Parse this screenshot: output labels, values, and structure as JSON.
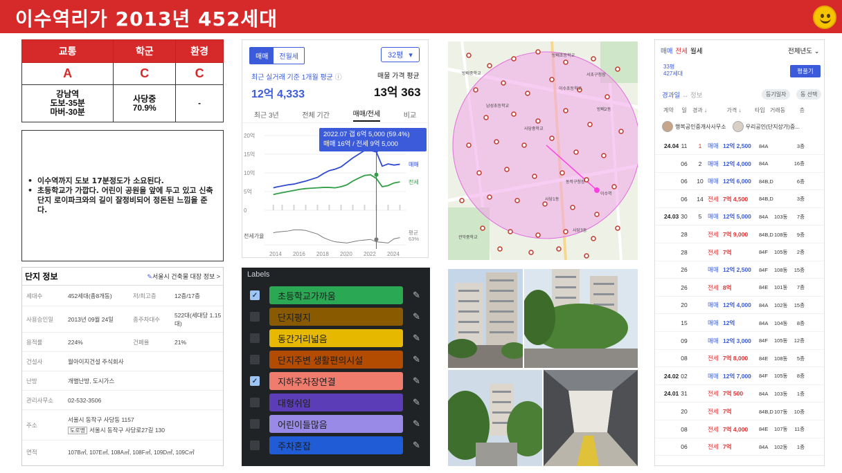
{
  "header": {
    "title": "이수역리가 2013년 452세대"
  },
  "scores": {
    "headers": [
      "교통",
      "학군",
      "환경"
    ],
    "grades": [
      "A",
      "C",
      "C"
    ],
    "details": [
      [
        "강남역",
        "도보-35분",
        "마버-30분"
      ],
      [
        "사당중",
        "70.9%"
      ],
      [
        "-"
      ]
    ]
  },
  "notes": [
    "이수역까지 도보 17분정도가 소요된다.",
    "초등학교가 가깝다. 어린이 공원을 앞에 두고 있고 신축단지 로이파크와의 길이 잘정비되어 정돈된 느낌을 준다."
  ],
  "complex": {
    "title": "단지 정보",
    "link": "서울시 건축물 대장 정보 >",
    "rows": [
      {
        "label": "세대수",
        "value": "452세대(총8개동)",
        "label2": "저/최고층",
        "value2": "12층/17층"
      },
      {
        "label": "사용승인일",
        "value": "2013년 09월 24일",
        "label2": "총주차대수",
        "value2": "522대(세대당 1.15대)"
      },
      {
        "label": "용적률",
        "value": "224%",
        "label2": "건폐율",
        "value2": "21%"
      },
      {
        "label": "건설사",
        "value": "월아이지건설 주식회사"
      },
      {
        "label": "난방",
        "value": "개별난방, 도시가스"
      },
      {
        "label": "관리사무소",
        "value": "02-532-3506"
      },
      {
        "label": "주소",
        "value": "서울시 동작구 사당동 1157",
        "road_tag": "도로명",
        "road": "서울시 동작구 사당로27길 130"
      },
      {
        "label": "면적",
        "value": "107B㎡, 107E㎡, 108A㎡, 108F㎡, 109D㎡, 109C㎡"
      }
    ]
  },
  "price_panel": {
    "tab_sale": "매매",
    "tab_rent": "전월세",
    "size": "32평",
    "avg_label": "최근 실거래 기준 1개월 평균",
    "avg_value": "12억 4,333",
    "sale_avg_label": "매물 가격 평균",
    "sale_avg_value": "13억 363",
    "period_tabs": [
      "최근 3년",
      "전체 기간",
      "매매/전세",
      "비교"
    ],
    "tooltip_line1": "2022.07  갭 6억 5,000 (59.4%)",
    "tooltip_line2": "매매 16억 / 전세 9억 5,000",
    "legend_sale": "매매",
    "legend_jeonse": "전세",
    "gap_label": "전세가율",
    "ratio_label": "평균",
    "ratio_value": "63%"
  },
  "chart_data": {
    "type": "line",
    "x": [
      2013.75,
      2014,
      2014.5,
      2015,
      2015.5,
      2016,
      2016.5,
      2017,
      2017.5,
      2018,
      2018.5,
      2019,
      2019.5,
      2020,
      2020.5,
      2021,
      2021.5,
      2022,
      2022.5,
      2023,
      2023.5,
      2024,
      2024.5
    ],
    "series": [
      {
        "name": "매매",
        "values": [
          6.0,
          6.2,
          6.5,
          6.8,
          7.0,
          7.4,
          7.8,
          8.3,
          8.8,
          9.8,
          10.6,
          11.0,
          11.6,
          12.8,
          14.0,
          15.0,
          16.0,
          16.0,
          15.6,
          11.8,
          12.4,
          12.1,
          12.3
        ]
      },
      {
        "name": "전세",
        "values": [
          4.2,
          4.4,
          4.7,
          5.0,
          5.3,
          5.6,
          5.8,
          5.9,
          6.0,
          6.1,
          6.1,
          6.0,
          6.3,
          6.8,
          7.8,
          8.6,
          9.3,
          9.5,
          8.5,
          6.3,
          6.6,
          7.3,
          7.6
        ]
      },
      {
        "name": "전세가율",
        "values": [
          70,
          71,
          72,
          73,
          75,
          75,
          74,
          71,
          68,
          62,
          58,
          55,
          54,
          53,
          55,
          57,
          58,
          59,
          55,
          54,
          53,
          60,
          62
        ]
      }
    ],
    "yticks": [
      "20억",
      "15억",
      "10억",
      "5억",
      "0"
    ],
    "xticks": [
      "2014",
      "2016",
      "2018",
      "2020",
      "2022",
      "2024"
    ],
    "ylim": [
      0,
      20
    ],
    "xlim": [
      2013,
      2025
    ]
  },
  "map": {
    "labels": [
      "방배중학교",
      "방배초등학교",
      "서초구청장",
      "사당중학교",
      "이수초등학교",
      "남성초등학교",
      "사당1동",
      "사당3동",
      "방배2동",
      "동작구청장",
      "관악중학교",
      "이수역"
    ]
  },
  "labels_panel": {
    "title": "Labels",
    "items": [
      {
        "text": "초등학교가까움",
        "checked": true,
        "color": "#2aa853"
      },
      {
        "text": "단지평지",
        "checked": false,
        "color": "#8a5a00"
      },
      {
        "text": "동간거리넓음",
        "checked": false,
        "color": "#e6b800"
      },
      {
        "text": "단지주변 생활편의시설",
        "checked": false,
        "color": "#b34b00"
      },
      {
        "text": "지하주차장연결",
        "checked": true,
        "color": "#f07c6e"
      },
      {
        "text": "대형쉬임",
        "checked": false,
        "color": "#5b3db8"
      },
      {
        "text": "어린이들많음",
        "checked": false,
        "color": "#9a8ae8"
      },
      {
        "text": "주차혼잡",
        "checked": false,
        "color": "#1f5cd6"
      }
    ]
  },
  "transactions": {
    "tab_sale": "매매",
    "tab_jeonse": "전세",
    "tab_monthly": "월세",
    "year_filter": "전체년도",
    "size_line1": "33평",
    "size_line2": "427세대",
    "plan_button": "평풀기",
    "sub_left": "경과일",
    "sub_info": "↔ 정보",
    "pill1": "등기일자",
    "pill2": "동 선택",
    "col_heads": [
      "계약",
      "일",
      "경과 ↓",
      "가격 ↓",
      "타입",
      "거래동",
      "층"
    ],
    "agent1": "행복공인중개사사무소",
    "agent2": "우리공인(단지상가)중...",
    "rows": [
      {
        "ym": "24.04",
        "d": "11",
        "lag": "1",
        "kind": "매매",
        "price": "12억 2,500",
        "type": "84A",
        "dong": "",
        "floor": "3층"
      },
      {
        "ym": "",
        "d": "06",
        "lag": "2",
        "kind": "매매",
        "price": "12억 4,000",
        "type": "84A",
        "dong": "",
        "floor": "16층"
      },
      {
        "ym": "",
        "d": "06",
        "lag": "10",
        "kind": "매매",
        "price": "12억 6,000",
        "type": "84B,D",
        "dong": "",
        "floor": "6층"
      },
      {
        "ym": "",
        "d": "06",
        "lag": "14",
        "kind": "전세",
        "price": "7억 4,500",
        "type": "84B,D",
        "dong": "",
        "floor": "3층"
      },
      {
        "ym": "24.03",
        "d": "30",
        "lag": "5",
        "kind": "매매",
        "price": "12억 5,000",
        "type": "84A",
        "dong": "103동",
        "floor": "7층"
      },
      {
        "ym": "",
        "d": "28",
        "lag": "",
        "kind": "전세",
        "price": "7억 9,000",
        "type": "84B,D",
        "dong": "108동",
        "floor": "9층"
      },
      {
        "ym": "",
        "d": "28",
        "lag": "",
        "kind": "전세",
        "price": "7억",
        "type": "84F",
        "dong": "105동",
        "floor": "2층"
      },
      {
        "ym": "",
        "d": "26",
        "lag": "",
        "kind": "매매",
        "price": "12억 2,500",
        "type": "84F",
        "dong": "108동",
        "floor": "15층"
      },
      {
        "ym": "",
        "d": "26",
        "lag": "",
        "kind": "전세",
        "price": "8억",
        "type": "84E",
        "dong": "101동",
        "floor": "7층"
      },
      {
        "ym": "",
        "d": "20",
        "lag": "",
        "kind": "매매",
        "price": "12억 4,000",
        "type": "84A",
        "dong": "102동",
        "floor": "15층"
      },
      {
        "ym": "",
        "d": "15",
        "lag": "",
        "kind": "매매",
        "price": "12억",
        "type": "84A",
        "dong": "104동",
        "floor": "8층"
      },
      {
        "ym": "",
        "d": "09",
        "lag": "",
        "kind": "매매",
        "price": "12억 3,000",
        "type": "84F",
        "dong": "105동",
        "floor": "12층"
      },
      {
        "ym": "",
        "d": "08",
        "lag": "",
        "kind": "전세",
        "price": "7억 8,000",
        "type": "84E",
        "dong": "108동",
        "floor": "5층"
      },
      {
        "ym": "24.02",
        "d": "02",
        "lag": "",
        "kind": "매매",
        "price": "12억 7,000",
        "type": "84F",
        "dong": "105동",
        "floor": "8층"
      },
      {
        "ym": "24.01",
        "d": "31",
        "lag": "",
        "kind": "전세",
        "price": "7억 500",
        "type": "84A",
        "dong": "103동",
        "floor": "1층"
      },
      {
        "ym": "",
        "d": "20",
        "lag": "",
        "kind": "전세",
        "price": "7억",
        "type": "84B,D",
        "dong": "107동",
        "floor": "10층"
      },
      {
        "ym": "",
        "d": "08",
        "lag": "",
        "kind": "전세",
        "price": "7억 4,000",
        "type": "84E",
        "dong": "107동",
        "floor": "11층"
      },
      {
        "ym": "",
        "d": "06",
        "lag": "",
        "kind": "전세",
        "price": "7억",
        "type": "84A",
        "dong": "102동",
        "floor": "1층"
      }
    ]
  }
}
